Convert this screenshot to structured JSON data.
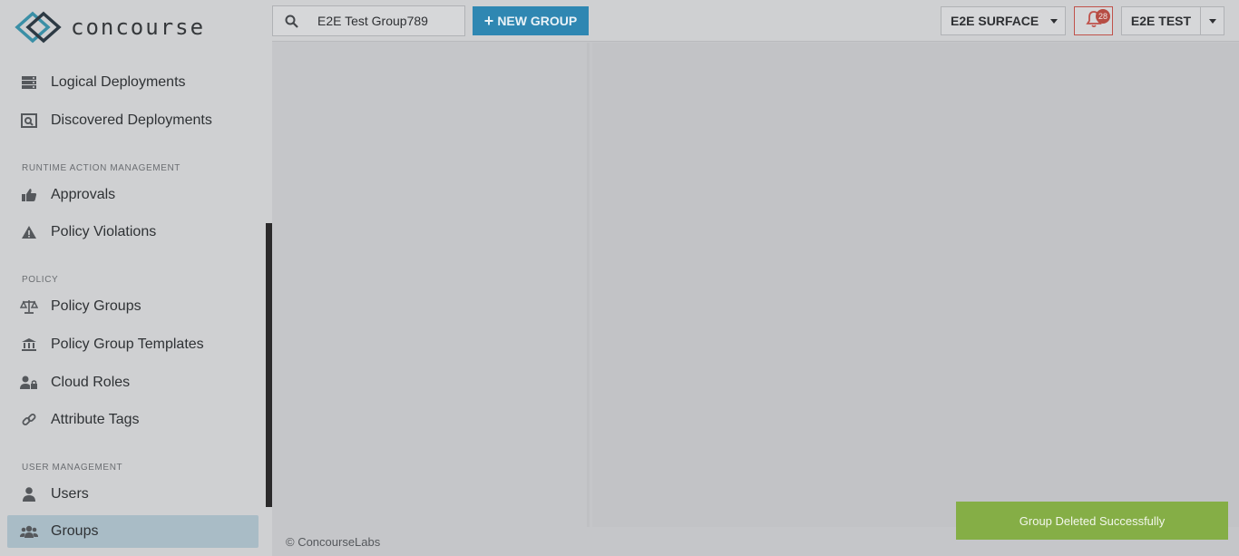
{
  "brand": {
    "name": "concourse"
  },
  "sidebar": {
    "items_top": [
      {
        "label": "Logical Deployments",
        "icon": "server-icon"
      },
      {
        "label": "Discovered Deployments",
        "icon": "discover-icon"
      }
    ],
    "sections": [
      {
        "title": "RUNTIME ACTION MANAGEMENT",
        "items": [
          {
            "label": "Approvals",
            "icon": "thumbs-up-icon"
          },
          {
            "label": "Policy Violations",
            "icon": "warning-icon"
          }
        ]
      },
      {
        "title": "POLICY",
        "items": [
          {
            "label": "Policy Groups",
            "icon": "balance-scale-icon"
          },
          {
            "label": "Policy Group Templates",
            "icon": "bank-icon"
          },
          {
            "label": "Cloud Roles",
            "icon": "user-lock-icon"
          },
          {
            "label": "Attribute Tags",
            "icon": "link-icon"
          }
        ]
      },
      {
        "title": "USER MANAGEMENT",
        "items": [
          {
            "label": "Users",
            "icon": "user-icon"
          },
          {
            "label": "Groups",
            "icon": "users-icon",
            "active": true
          }
        ]
      }
    ]
  },
  "topbar": {
    "search_value": "E2E Test Group789",
    "new_group_label": "NEW GROUP",
    "environment": "E2E SURFACE",
    "notification_count": "28",
    "user_name": "E2E TEST"
  },
  "footer": {
    "copyright": "© ConcourseLabs"
  },
  "toast": {
    "message": "Group Deleted Successfully",
    "color": "#85ae46"
  },
  "colors": {
    "accent": "#2f87b2",
    "active_nav": "#a9bcc6",
    "alert": "#b64d44"
  }
}
